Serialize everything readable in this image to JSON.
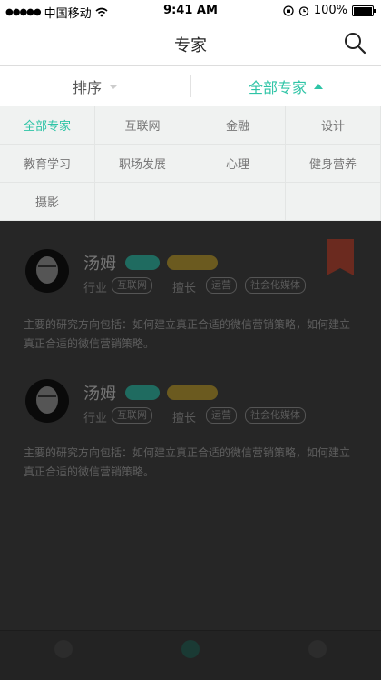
{
  "status": {
    "carrier": "中国移动",
    "time": "9:41 AM",
    "battery": "100%"
  },
  "nav": {
    "title": "专家"
  },
  "filter": {
    "sort_label": "排序",
    "all_label": "全部专家"
  },
  "categories": [
    "全部专家",
    "互联网",
    "金融",
    "设计",
    "教育学习",
    "职场发展",
    "心理",
    "健身营养",
    "摄影"
  ],
  "experts": [
    {
      "name": "汤姆",
      "industry_label": "行业",
      "industry": "互联网",
      "skill_label": "擅长",
      "skills": [
        "运营",
        "社会化媒体"
      ],
      "description": "主要的研究方向包括：如何建立真正合适的微信营销策略，如何建立真正合适的微信营销策略。"
    },
    {
      "name": "汤姆",
      "industry_label": "行业",
      "industry": "互联网",
      "skill_label": "擅长",
      "skills": [
        "运营",
        "社会化媒体"
      ],
      "description": "主要的研究方向包括：如何建立真正合适的微信营销策略，如何建立真正合适的微信营销策略。"
    }
  ],
  "colors": {
    "accent": "#2ec4a6",
    "overlay": "#262626"
  }
}
